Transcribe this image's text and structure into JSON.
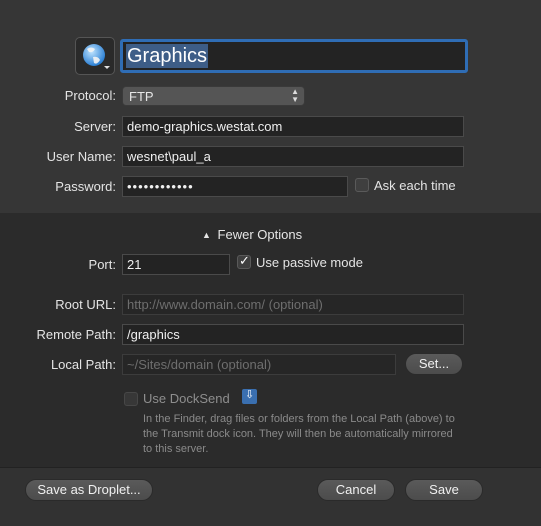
{
  "site": {
    "name": "Graphics",
    "icon": "globe-icon"
  },
  "labels": {
    "protocol": "Protocol:",
    "server": "Server:",
    "user_name": "User Name:",
    "password": "Password:",
    "port": "Port:",
    "root_url": "Root URL:",
    "remote_path": "Remote Path:",
    "local_path": "Local Path:"
  },
  "fields": {
    "protocol": "FTP",
    "server": "demo-graphics.westat.com",
    "user_name": "wesnet\\paul_a",
    "password": "••••••••••••",
    "port": "21",
    "root_url_placeholder": "http://www.domain.com/ (optional)",
    "remote_path": "/graphics",
    "local_path_placeholder": "~/Sites/domain (optional)"
  },
  "checkboxes": {
    "ask_each_time": {
      "label": "Ask each time",
      "checked": false
    },
    "use_passive_mode": {
      "label": "Use passive mode",
      "checked": true
    },
    "use_docksend": {
      "label": "Use DockSend",
      "checked": false
    }
  },
  "toggle": {
    "label": "Fewer Options",
    "icon": "triangle-up-icon"
  },
  "buttons": {
    "set": "Set...",
    "save_as_droplet": "Save as Droplet...",
    "cancel": "Cancel",
    "save": "Save"
  },
  "docksend_help": [
    "In the Finder, drag files or folders from the Local Path (above) to",
    "the Transmit dock icon. They will then be automatically mirrored",
    "to this server."
  ],
  "colors": {
    "focus_ring": "#2f6db5",
    "panel_top": "#363636",
    "panel_bottom": "#2b2b2b"
  }
}
